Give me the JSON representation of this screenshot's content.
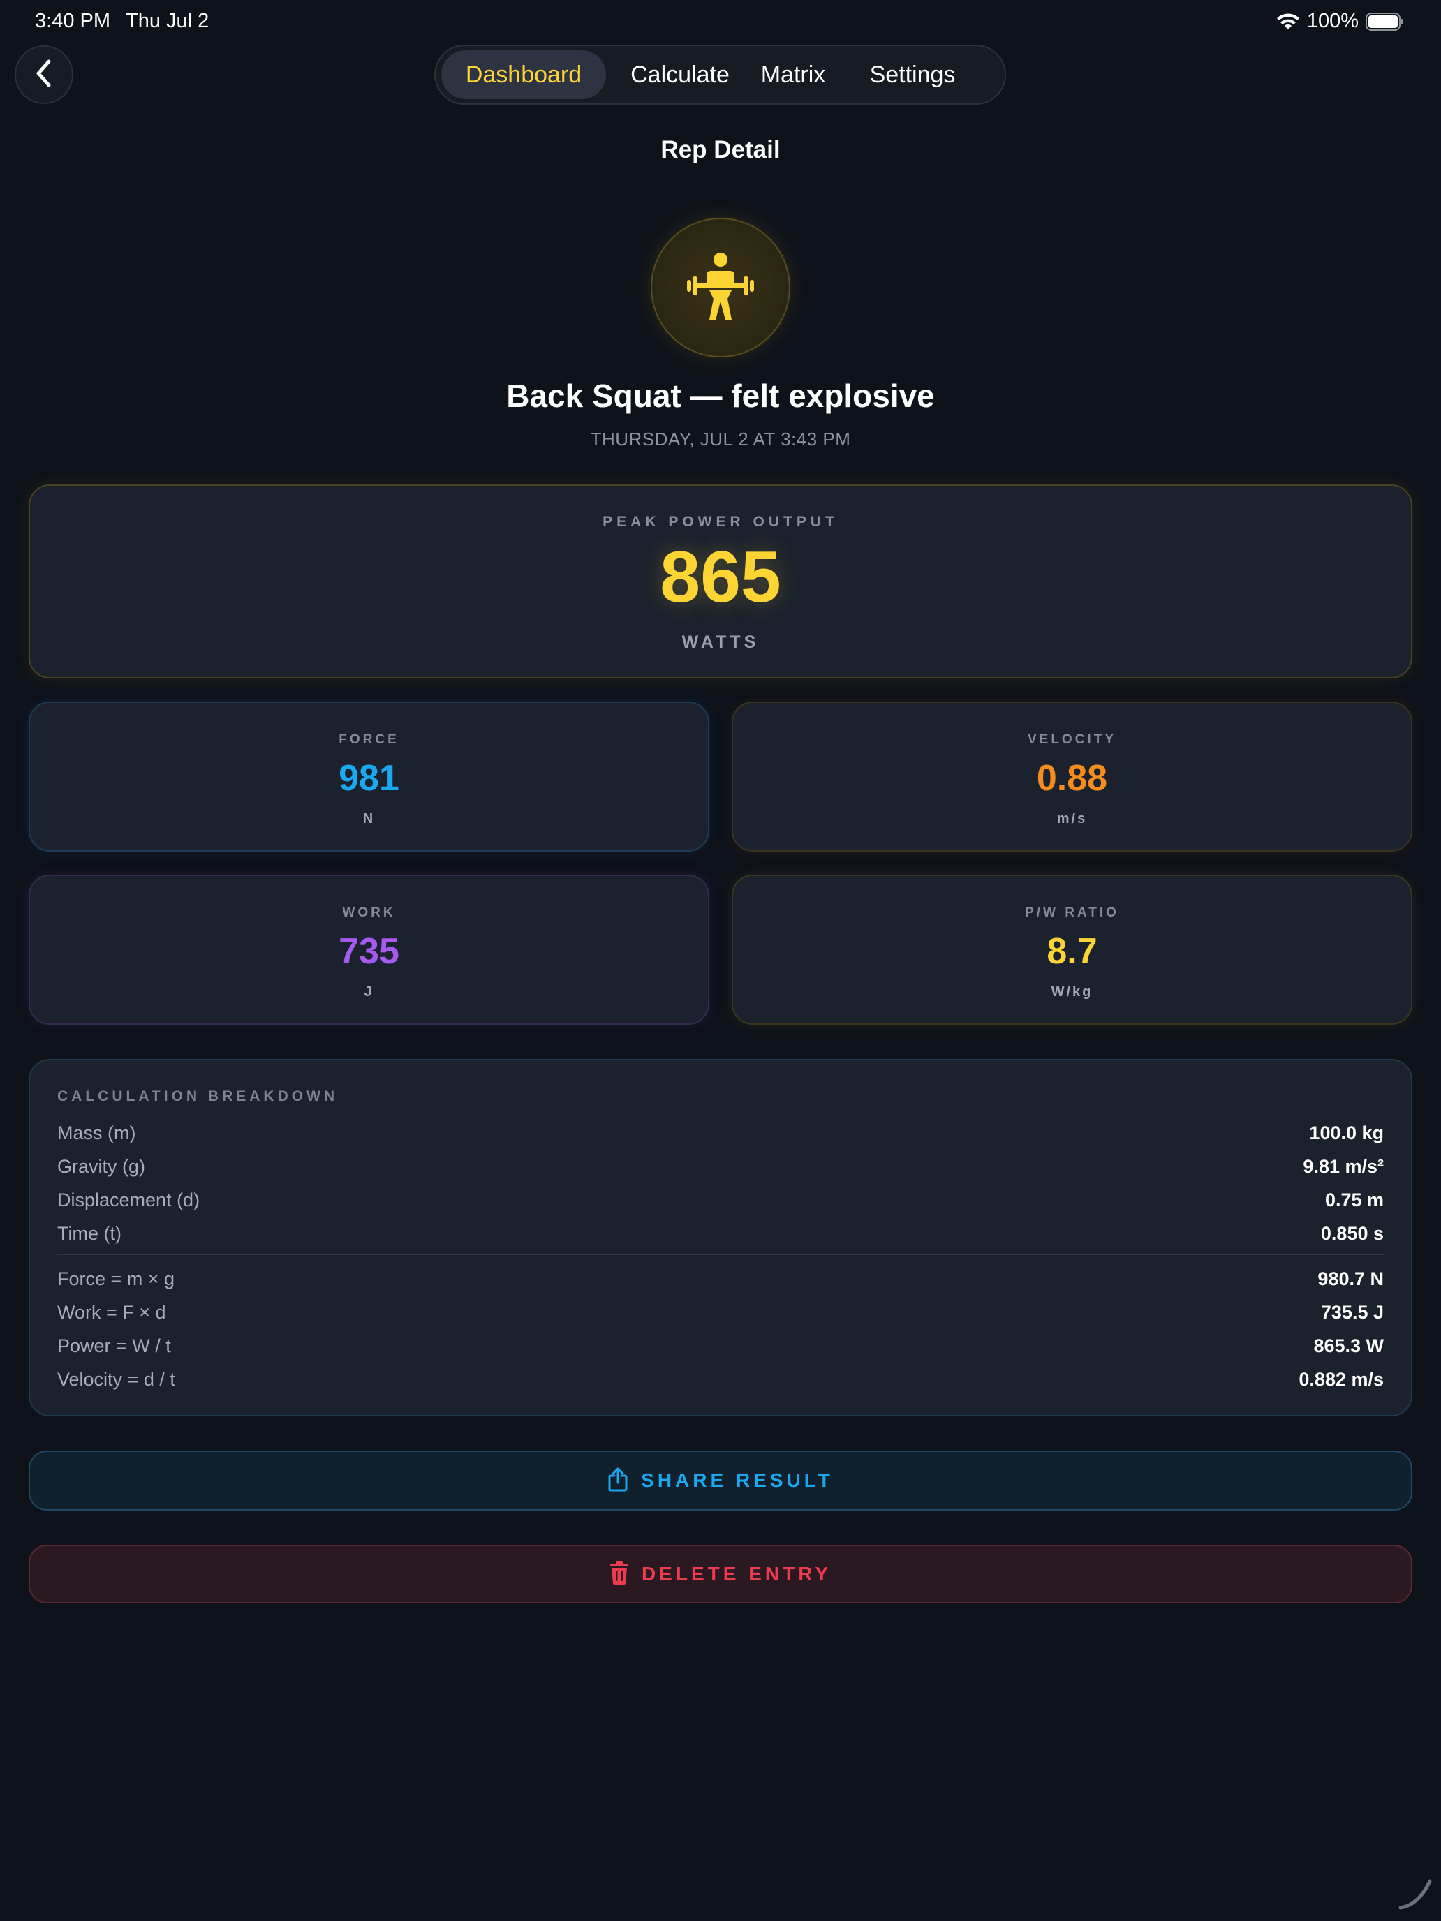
{
  "status_bar": {
    "time": "3:40 PM",
    "date": "Thu Jul 2",
    "battery": "100%"
  },
  "nav": {
    "tabs": [
      {
        "label": "Dashboard",
        "active": true
      },
      {
        "label": "Calculate",
        "active": false
      },
      {
        "label": "Matrix",
        "active": false
      },
      {
        "label": "Settings",
        "active": false
      }
    ]
  },
  "screen_title": "Rep Detail",
  "entry": {
    "icon": "weightlifter-icon",
    "title": "Back Squat — felt explosive",
    "date": "THURSDAY, JUL 2 AT 3:43 PM"
  },
  "peak": {
    "label": "PEAK POWER OUTPUT",
    "value": "865",
    "unit": "WATTS"
  },
  "metrics": {
    "force": {
      "label": "FORCE",
      "value": "981",
      "unit": "N",
      "color": "#1aa9f0"
    },
    "velocity": {
      "label": "VELOCITY",
      "value": "0.88",
      "unit": "m/s",
      "color": "#f78c1e"
    },
    "work": {
      "label": "WORK",
      "value": "735",
      "unit": "J",
      "color": "#a65af2"
    },
    "ratio": {
      "label": "P/W RATIO",
      "value": "8.7",
      "unit": "W/kg",
      "color": "#fcd535"
    }
  },
  "breakdown": {
    "heading": "CALCULATION BREAKDOWN",
    "inputs": [
      {
        "label": "Mass (m)",
        "value": "100.0 kg"
      },
      {
        "label": "Gravity (g)",
        "value": "9.81 m/s²"
      },
      {
        "label": "Displacement (d)",
        "value": "0.75 m"
      },
      {
        "label": "Time (t)",
        "value": "0.850 s"
      }
    ],
    "results": [
      {
        "label": "Force = m × g",
        "value": "980.7 N"
      },
      {
        "label": "Work = F × d",
        "value": "735.5 J"
      },
      {
        "label": "Power = W / t",
        "value": "865.3 W"
      },
      {
        "label": "Velocity = d / t",
        "value": "0.882 m/s"
      }
    ]
  },
  "actions": {
    "share_label": "SHARE RESULT",
    "share_icon": "share-icon",
    "delete_label": "DELETE ENTRY",
    "delete_icon": "trash-icon"
  },
  "colors": {
    "accent": "#fcd535",
    "background": "#0e121a",
    "share": "#1aa9f0",
    "delete": "#ee3b4f"
  }
}
